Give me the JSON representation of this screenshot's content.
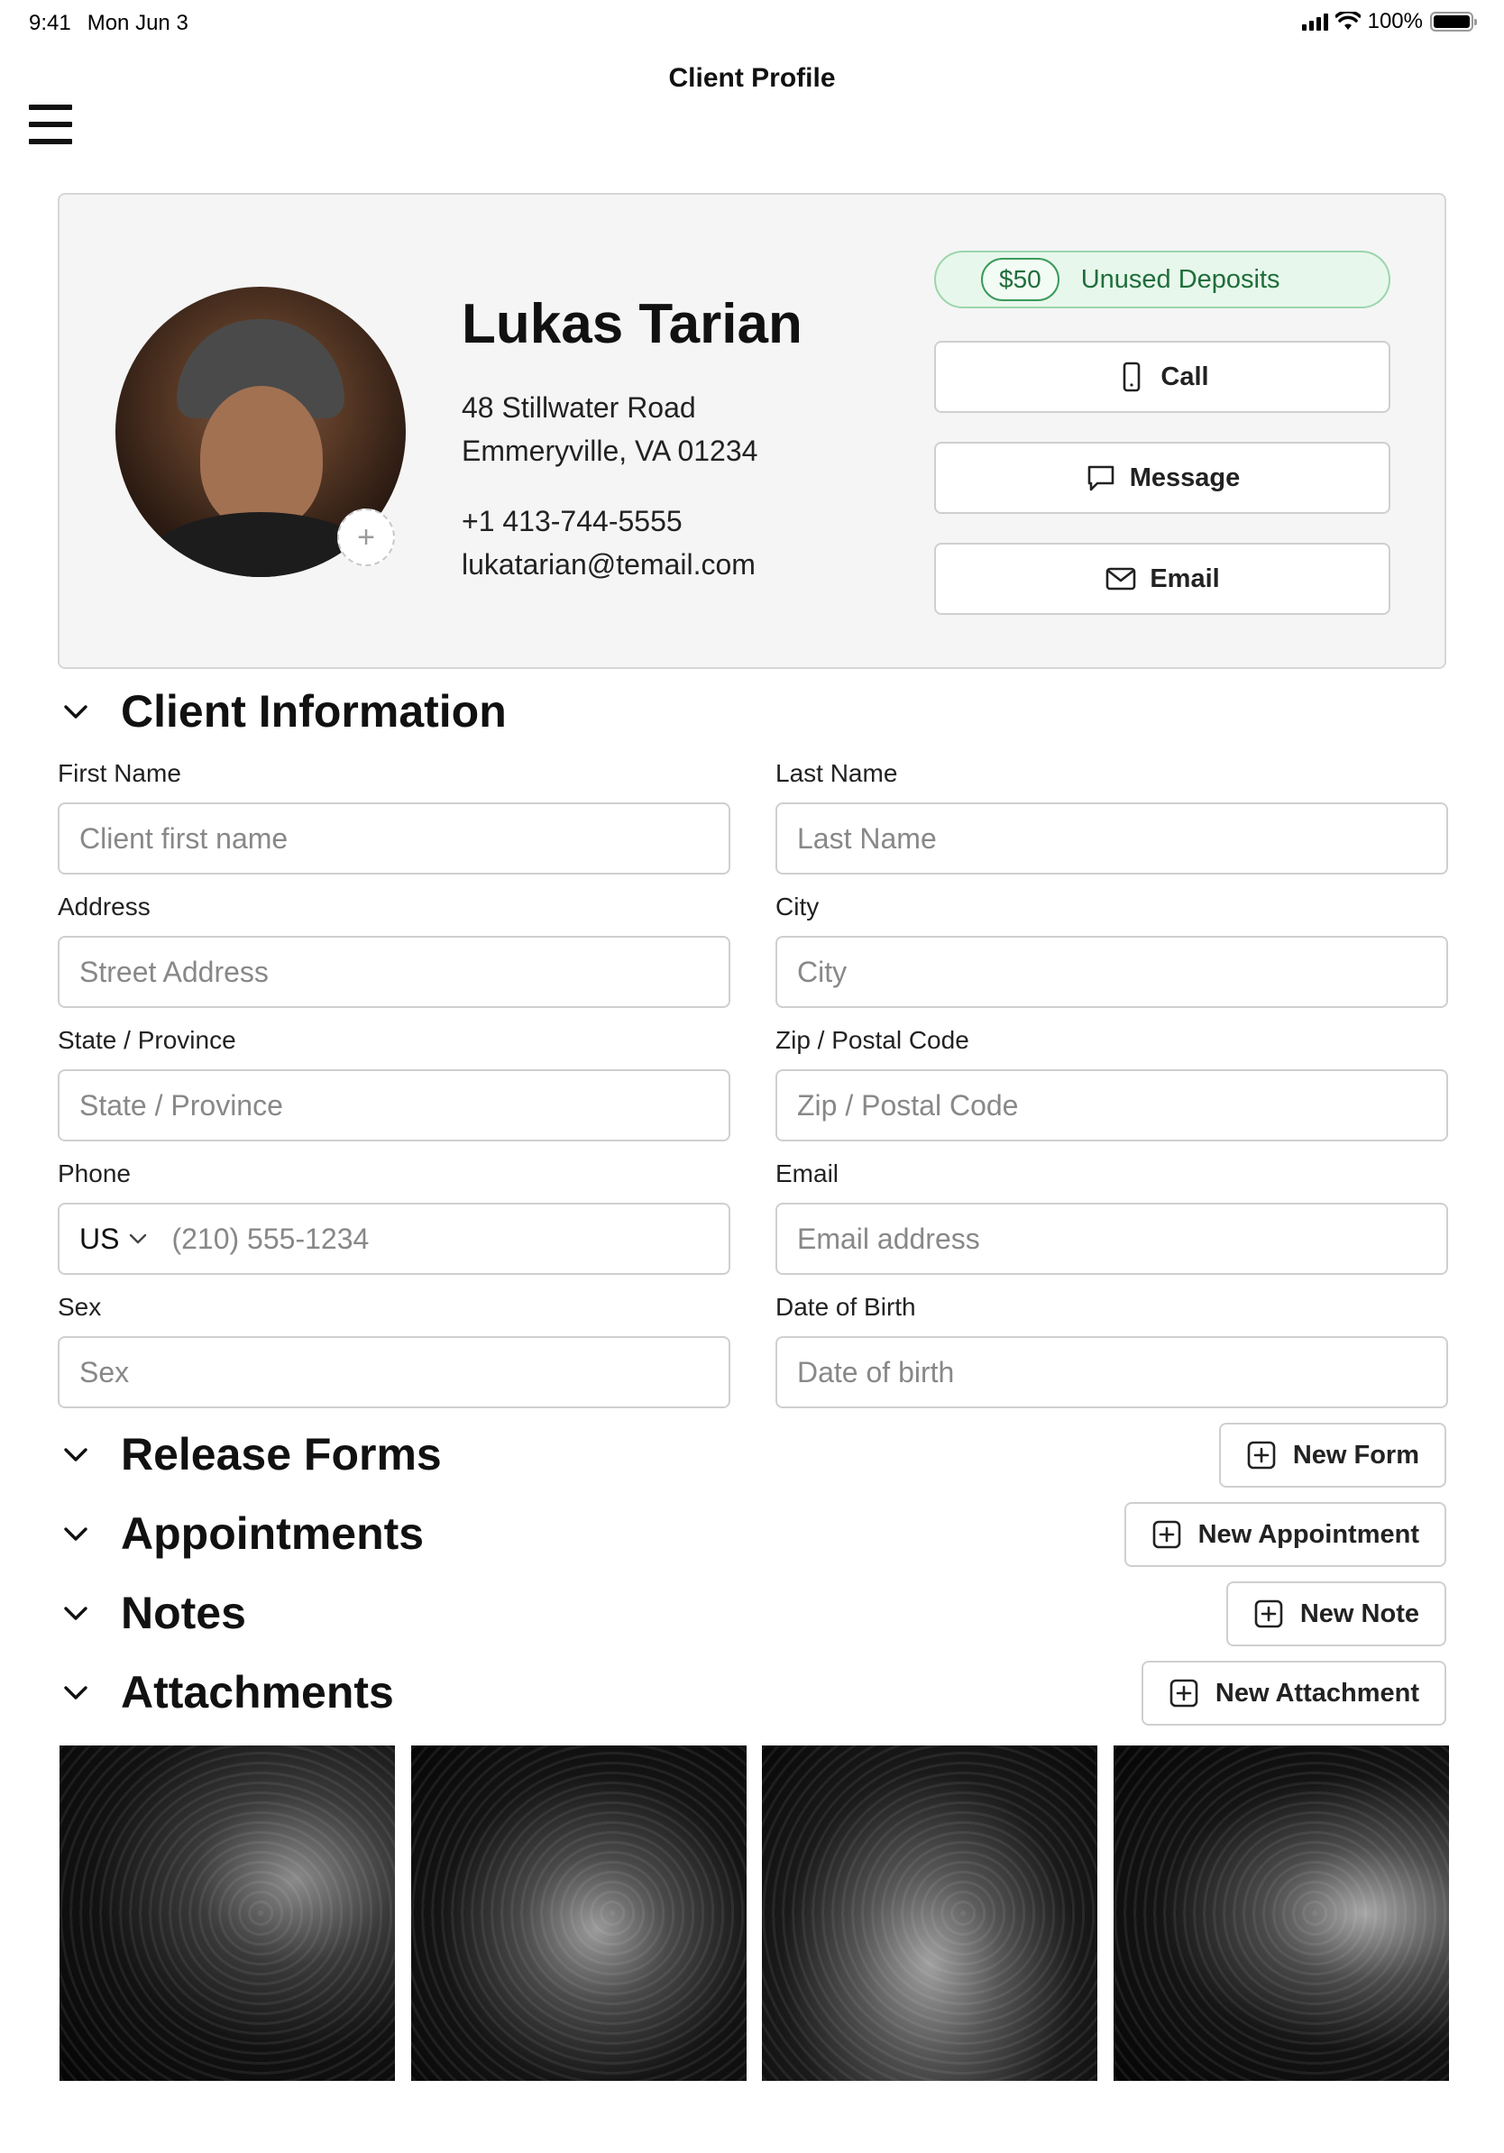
{
  "status_bar": {
    "time": "9:41",
    "date": "Mon Jun 3",
    "battery": "100%",
    "battery_level": 1.0
  },
  "header": {
    "title": "Client Profile",
    "menu_icon": "hamburger-menu-icon"
  },
  "profile": {
    "name": "Lukas Tarian",
    "address_line1": "48 Stillwater Road",
    "address_line2": "Emmeryville, VA 01234",
    "phone": "+1 413-744-5555",
    "email": "lukatarian@temail.com",
    "avatar_add_symbol": "+",
    "deposit_amount": "$50",
    "deposit_label": "Unused Deposits",
    "actions": {
      "call": "Call",
      "message": "Message",
      "email": "Email"
    }
  },
  "client_info": {
    "title": "Client Information",
    "fields": {
      "first_name": {
        "label": "First Name",
        "placeholder": "Client first name"
      },
      "last_name": {
        "label": "Last Name",
        "placeholder": "Last Name"
      },
      "address": {
        "label": "Address",
        "placeholder": "Street Address"
      },
      "city": {
        "label": "City",
        "placeholder": "City"
      },
      "state": {
        "label": "State / Province",
        "placeholder": "State / Province"
      },
      "zip": {
        "label": "Zip / Postal Code",
        "placeholder": "Zip / Postal Code"
      },
      "phone": {
        "label": "Phone",
        "country": "US",
        "placeholder": "(210) 555-1234"
      },
      "email": {
        "label": "Email",
        "placeholder": "Email address"
      },
      "sex": {
        "label": "Sex",
        "placeholder": "Sex"
      },
      "dob": {
        "label": "Date of Birth",
        "placeholder": "Date of birth"
      }
    }
  },
  "sections": {
    "release_forms": {
      "title": "Release Forms",
      "button": "New Form"
    },
    "appointments": {
      "title": "Appointments",
      "button": "New Appointment"
    },
    "notes": {
      "title": "Notes",
      "button": "New Note"
    },
    "attachments": {
      "title": "Attachments",
      "button": "New Attachment"
    }
  },
  "colors": {
    "accent_green": "#1f6e3a",
    "deposit_bg": "#e8f7ec",
    "border": "#cfcfcf",
    "card_bg": "#f5f5f5"
  }
}
